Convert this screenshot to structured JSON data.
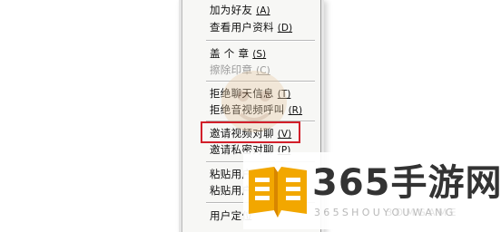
{
  "menu": {
    "groups": [
      [
        {
          "label": "加为好友",
          "accel": "(A)",
          "disabled": false
        },
        {
          "label": "查看用户资料",
          "accel": "(D)",
          "disabled": false
        }
      ],
      [
        {
          "label": "盖 个 章",
          "accel": "(S)",
          "disabled": false
        },
        {
          "label": "擦除印章",
          "accel": "(C)",
          "disabled": true
        }
      ],
      [
        {
          "label": "拒绝聊天信息",
          "accel": "(T)",
          "disabled": false
        },
        {
          "label": "拒绝音视频呼叫",
          "accel": "(R)",
          "disabled": false
        }
      ],
      [
        {
          "label": "邀请视频对聊",
          "accel": "(V)",
          "disabled": false
        },
        {
          "label": "邀请私密对聊",
          "accel": "(P)",
          "disabled": false
        }
      ],
      [
        {
          "label": "粘贴用户",
          "accel": "",
          "disabled": false
        },
        {
          "label": "粘贴用户",
          "accel": "",
          "disabled": false
        }
      ],
      [
        {
          "label": "用户定位",
          "accel": "",
          "disabled": false
        }
      ]
    ]
  },
  "highlighted_item": "邀请视频对聊",
  "watermark": {
    "title": "365手游网",
    "subtitle": "365SHOUYOUWANG",
    "overlay_text": "3DMGAME",
    "colors": {
      "book": "#f2a700",
      "book_dark": "#d88600",
      "text": "#333333",
      "highlight_box": "#d21f2a"
    }
  }
}
